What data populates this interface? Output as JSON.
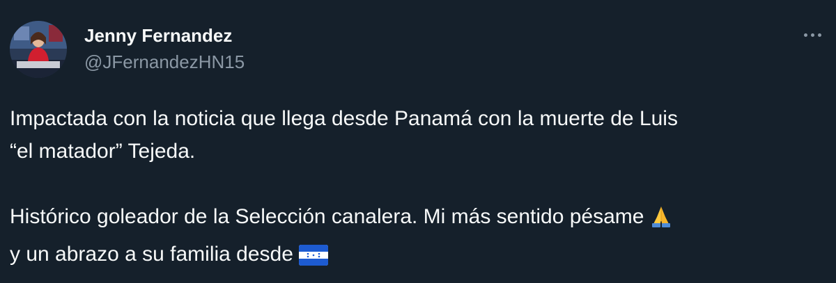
{
  "tweet": {
    "author": {
      "display_name": "Jenny Fernandez",
      "handle": "@JFernandezHN15"
    },
    "more_icon": "more-horizontal-icon",
    "body": {
      "line1": "Impactada con la noticia que llega desde Panamá con la muerte de Luis",
      "line2": "“el matador” Tejeda.",
      "line3": "Histórico goleador de la Selección canalera. Mi más sentido pésame",
      "line3_emoji": "folded-hands-emoji",
      "line4": "y un abrazo a su familia desde",
      "line4_emoji": "honduras-flag-emoji"
    }
  },
  "colors": {
    "background": "#15202b",
    "primary_text": "#f7f9f9",
    "secondary_text": "#8b98a5",
    "flag_blue": "#1d5bd1",
    "emoji_yellow": "#ffc83d"
  }
}
